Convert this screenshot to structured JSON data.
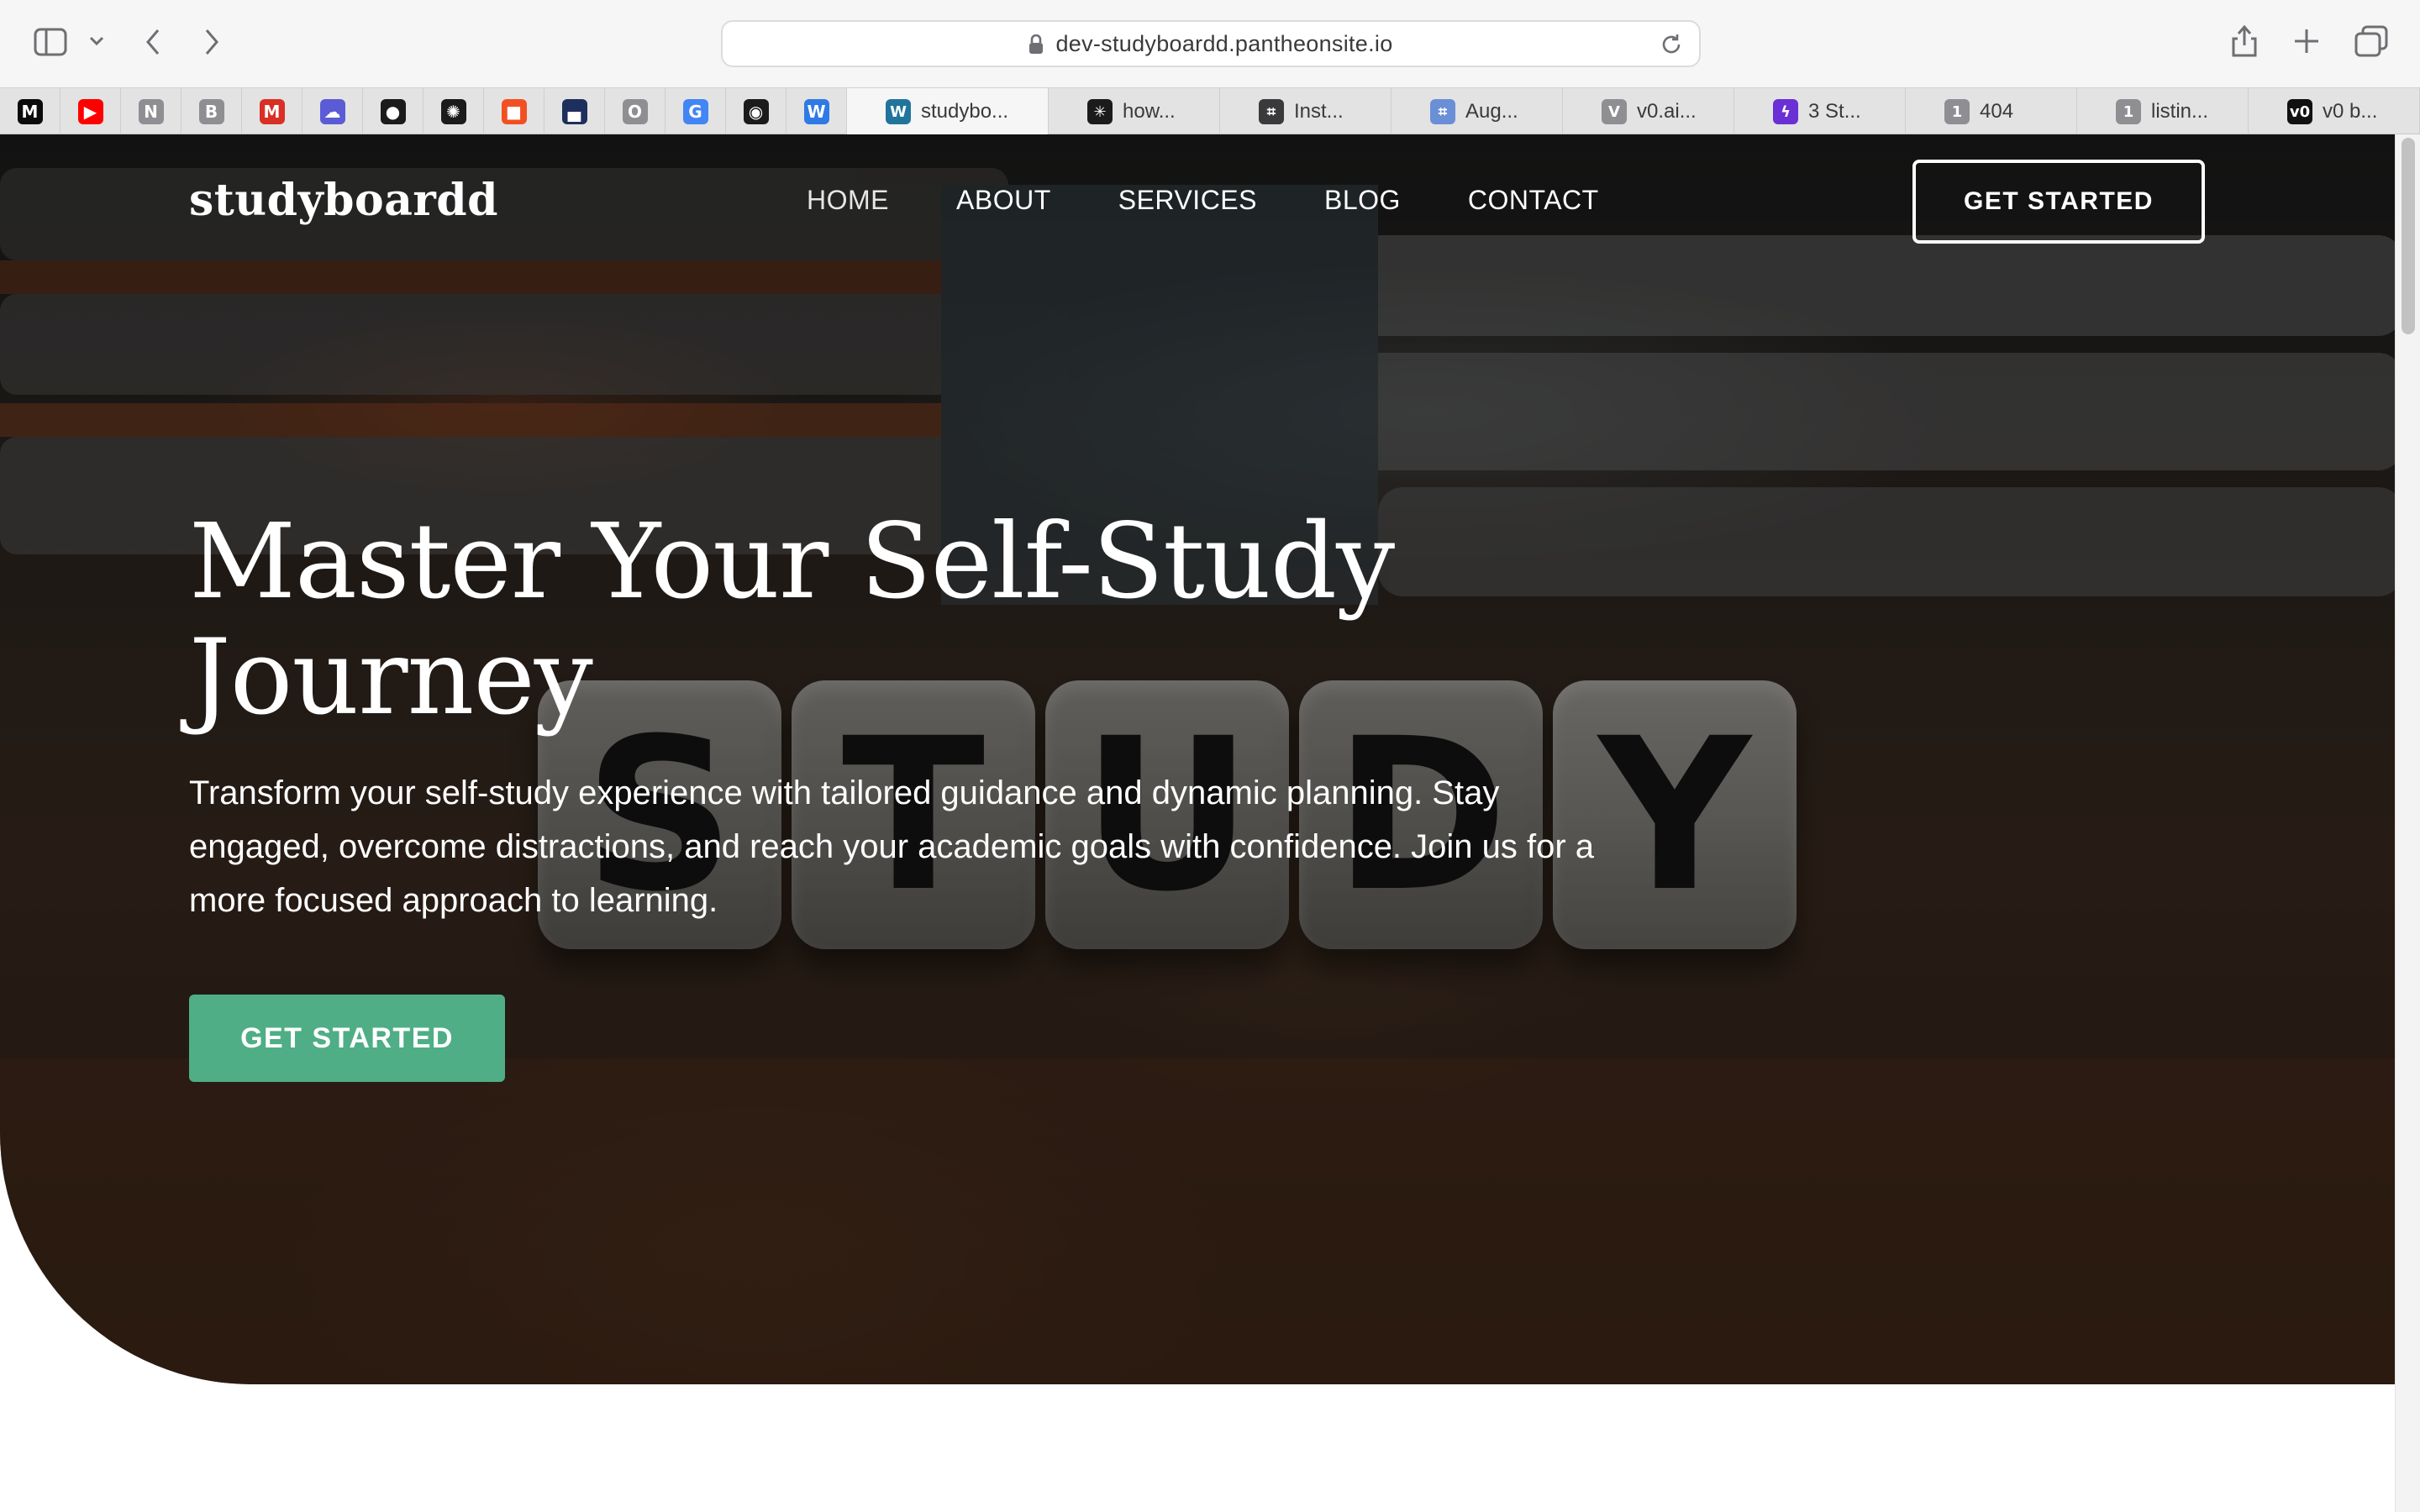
{
  "browser": {
    "url": "dev-studyboardd.pantheonsite.io",
    "pinned_tabs": [
      {
        "icon": "medium-icon",
        "label": "M",
        "color": "#0b0b0b"
      },
      {
        "icon": "youtube-icon",
        "label": "▶",
        "color": "#ff0000"
      },
      {
        "icon": "notion-icon",
        "label": "N",
        "color": "#8e8e93"
      },
      {
        "icon": "b-icon",
        "label": "B",
        "color": "#8e8e93"
      },
      {
        "icon": "gmail-icon",
        "label": "M",
        "color": "#d93025"
      },
      {
        "icon": "cloud-icon",
        "label": "☁",
        "color": "#5b5bd6"
      },
      {
        "icon": "github-icon",
        "label": "●",
        "color": "#1b1b1b"
      },
      {
        "icon": "openai-icon",
        "label": "✺",
        "color": "#1b1b1b"
      },
      {
        "icon": "microsoft-icon",
        "label": "■",
        "color": "#f25022"
      },
      {
        "icon": "app-icon",
        "label": "▄",
        "color": "#1d2f5c"
      },
      {
        "icon": "o-icon",
        "label": "O",
        "color": "#8e8e93"
      },
      {
        "icon": "google-icon",
        "label": "G",
        "color": "#4285f4"
      },
      {
        "icon": "circle-icon",
        "label": "◉",
        "color": "#1b1b1b"
      },
      {
        "icon": "w-icon",
        "label": "W",
        "color": "#2f7ae5"
      }
    ],
    "tabs": [
      {
        "icon": "wordpress-icon",
        "glyph": "W",
        "color": "#21759b",
        "label": "studybo...",
        "active": true
      },
      {
        "icon": "perplexity-icon",
        "glyph": "✳",
        "color": "#1b1b1b",
        "label": "how...",
        "active": false
      },
      {
        "icon": "screenshot-icon",
        "glyph": "⌗",
        "color": "#3a3a3c",
        "label": "Inst...",
        "active": false
      },
      {
        "icon": "screenshot-icon",
        "glyph": "⌗",
        "color": "#6b8fd6",
        "label": "Aug...",
        "active": false
      },
      {
        "icon": "v-icon",
        "glyph": "V",
        "color": "#8e8e93",
        "label": "v0.ai...",
        "active": false
      },
      {
        "icon": "lightning-icon",
        "glyph": "ϟ",
        "color": "#6b2fd6",
        "label": "3 St...",
        "active": false
      },
      {
        "icon": "one-icon",
        "glyph": "1",
        "color": "#8e8e93",
        "label": "404",
        "active": false
      },
      {
        "icon": "one-icon",
        "glyph": "1",
        "color": "#8e8e93",
        "label": "listin...",
        "active": false
      },
      {
        "icon": "v0-icon",
        "glyph": "v0",
        "color": "#111111",
        "label": "v0 b...",
        "active": false
      }
    ]
  },
  "site": {
    "logo": "studyboardd",
    "nav": [
      "HOME",
      "ABOUT",
      "SERVICES",
      "BLOG",
      "CONTACT"
    ],
    "header_cta": "GET STARTED"
  },
  "hero": {
    "title": "Master Your Self-Study Journey",
    "description": "Transform your self-study experience with tailored guidance and dynamic planning. Stay engaged, overcome distractions, and reach your academic goals with confidence. Join us for a more focused approach to learning.",
    "cta": "GET STARTED",
    "cta_color": "#4fae85",
    "image_letters": [
      "S",
      "T",
      "U",
      "D",
      "Y"
    ]
  }
}
